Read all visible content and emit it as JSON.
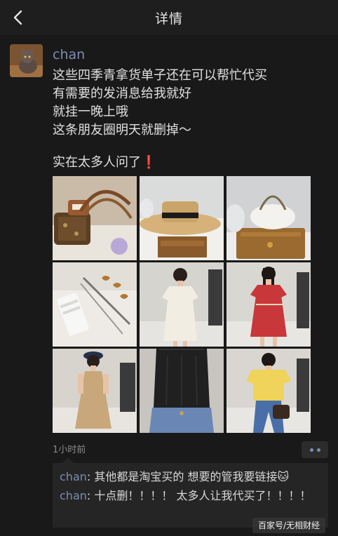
{
  "header": {
    "title": "详情",
    "back_icon": "chevron-left-icon"
  },
  "post": {
    "username": "chan",
    "avatar": "cat-avatar",
    "text_lines": [
      "这些四季青拿货单子还在可以帮忙代买",
      "有需要的发消息给我就好",
      "就挂一晚上哦",
      "这条朋友圈明天就删掉～"
    ],
    "question_line": "实在太多人问了",
    "question_emoji": "❗",
    "images": [
      "handbags-photo",
      "straw-hat-photo",
      "white-bag-photo",
      "hair-clips-photo",
      "white-dress-photo",
      "red-dress-photo",
      "khaki-dress-photo",
      "black-top-photo",
      "yellow-tee-photo"
    ],
    "time": "1小时前"
  },
  "comments": [
    {
      "author": "chan",
      "separator": ": ",
      "text": "其他都是淘宝买的 想要的管我要链接🐱"
    },
    {
      "author": "chan",
      "separator": ": ",
      "text": "十点删！！！！ 太多人让我代买了！！！！"
    }
  ],
  "watermark": "百家号/无相财经",
  "colors": {
    "background": "#191919",
    "name": "#7c8db0",
    "text": "#e0e0e0",
    "exclamation": "#e0322a"
  }
}
